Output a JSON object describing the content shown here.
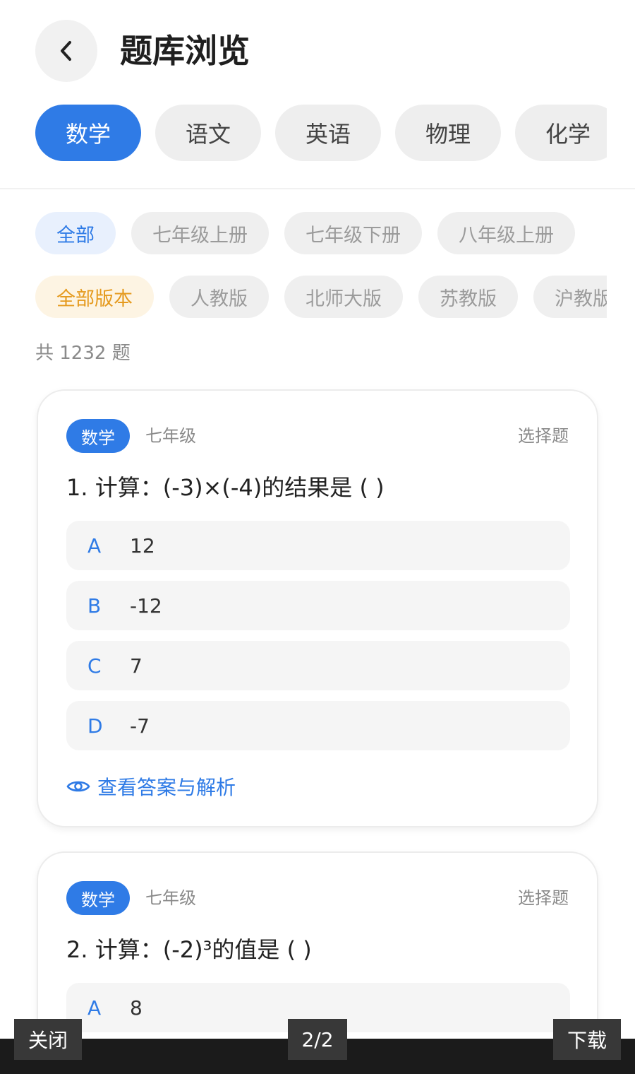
{
  "header": {
    "title": "题库浏览",
    "back_icon": "chevron-left-icon"
  },
  "subjects": [
    {
      "label": "数学",
      "active": true
    },
    {
      "label": "语文",
      "active": false
    },
    {
      "label": "英语",
      "active": false
    },
    {
      "label": "物理",
      "active": false
    },
    {
      "label": "化学",
      "active": false
    }
  ],
  "grades": [
    "全部",
    "七年级上册",
    "七年级下册",
    "八年级上册"
  ],
  "versions": [
    "全部版本",
    "人教版",
    "北师大版",
    "苏教版",
    "沪教版"
  ],
  "total_count": "共 1232 题",
  "questions": [
    {
      "subject": "数学",
      "grade": "七年级",
      "type": "选择题",
      "text": "1. 计算：(-3)×(-4)的结果是 ( )",
      "options": [
        {
          "letter": "A",
          "text": "12"
        },
        {
          "letter": "B",
          "text": "-12"
        },
        {
          "letter": "C",
          "text": "7"
        },
        {
          "letter": "D",
          "text": "-7"
        }
      ],
      "analysis_link": "查看答案与解析"
    },
    {
      "subject": "数学",
      "grade": "七年级",
      "type": "选择题",
      "text": "2. 计算：(-2)³的值是 ( )",
      "options": [
        {
          "letter": "A",
          "text": "8"
        }
      ]
    }
  ],
  "viewer": {
    "close_label": "关闭",
    "page_indicator": "2/2",
    "download_label": "下载"
  },
  "colors": {
    "accent": "#2f7be6",
    "chip_bg": "#efefef",
    "version_active": "#e59a1e",
    "viewer_bar": "#1b1b1b"
  }
}
